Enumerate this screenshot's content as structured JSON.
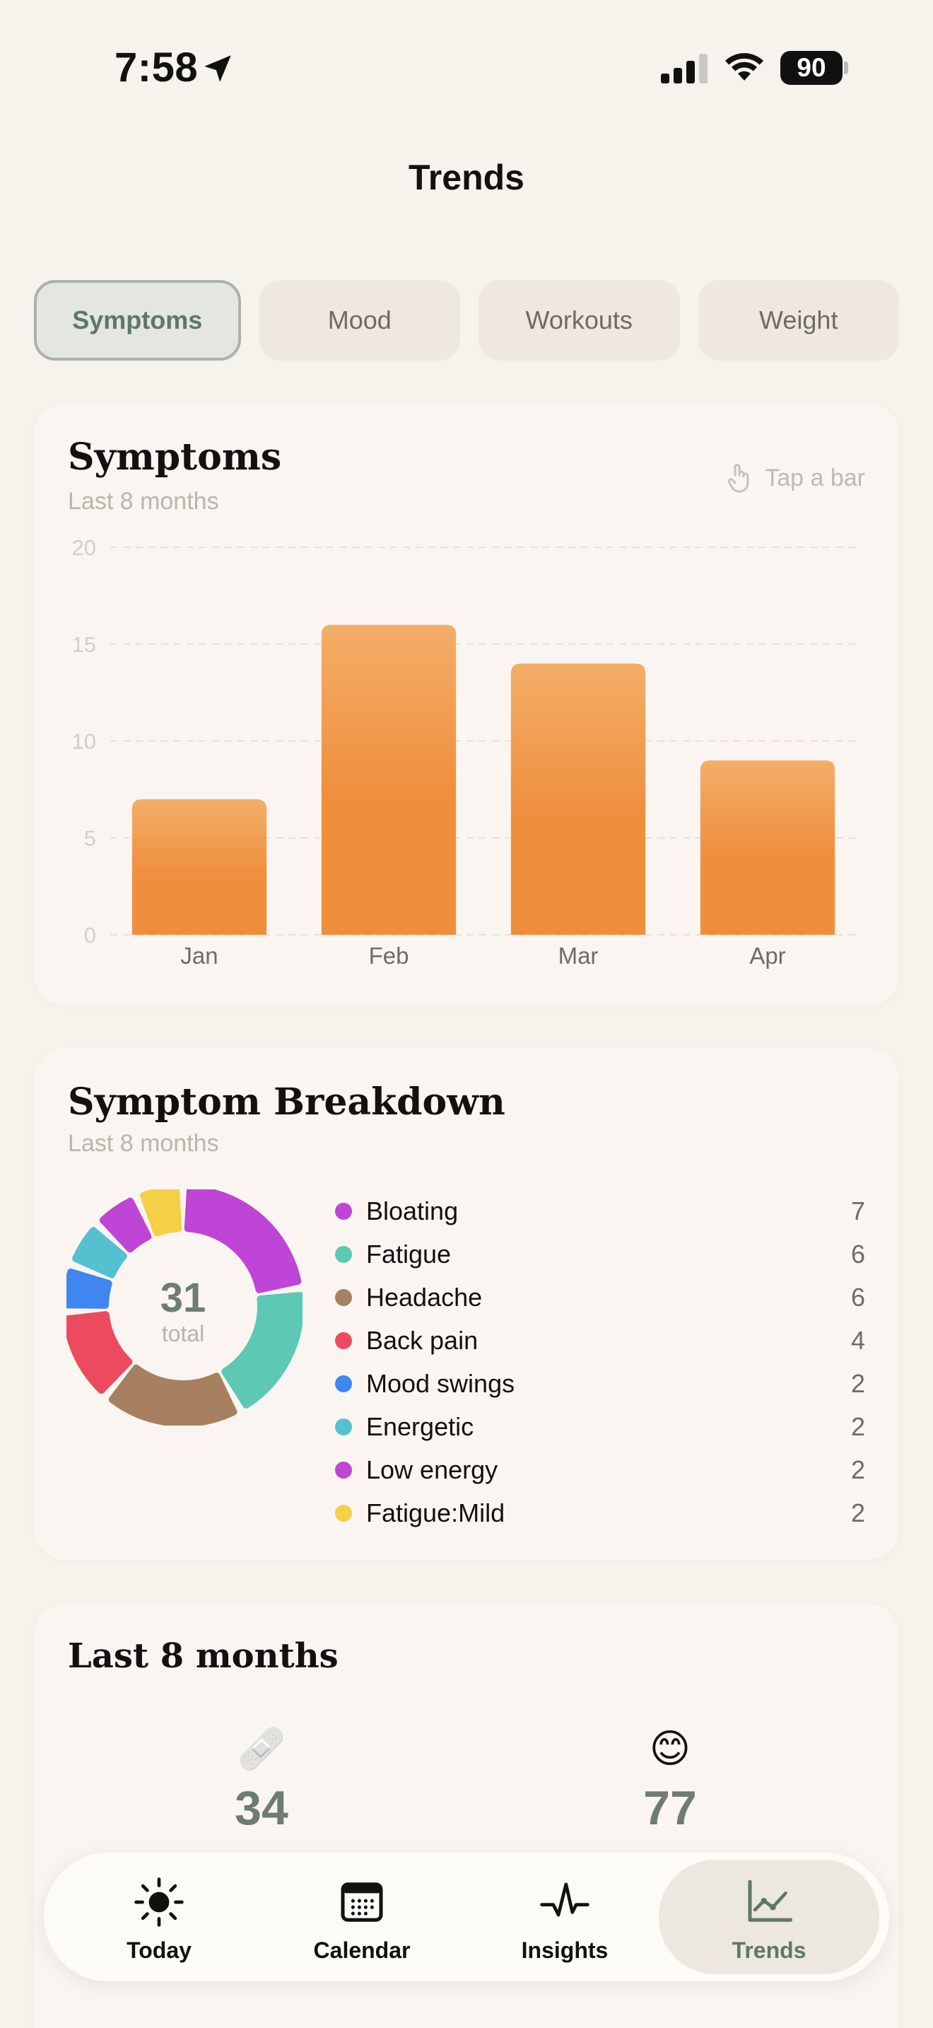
{
  "status_bar": {
    "time": "7:58",
    "battery": "90"
  },
  "page": {
    "title": "Trends"
  },
  "tabs": [
    {
      "label": "Symptoms",
      "active": true
    },
    {
      "label": "Mood",
      "active": false
    },
    {
      "label": "Workouts",
      "active": false
    },
    {
      "label": "Weight",
      "active": false
    }
  ],
  "symptoms_chart": {
    "title": "Symptoms",
    "subtitle": "Last 8 months",
    "hint": "Tap a bar",
    "bar_color_top": "#f3ae68",
    "bar_color_bottom": "#ef8f3e"
  },
  "chart_data": {
    "type": "bar",
    "categories": [
      "Jan",
      "Feb",
      "Mar",
      "Apr"
    ],
    "values": [
      7,
      16,
      14,
      9
    ],
    "yticks": [
      0,
      5,
      10,
      15,
      20
    ],
    "ylim": [
      0,
      20
    ],
    "grid": "dashed horizontal"
  },
  "breakdown": {
    "title": "Symptom Breakdown",
    "subtitle": "Last 8 months",
    "total": "31",
    "total_label": "total",
    "items": [
      {
        "label": "Bloating",
        "count": "7",
        "value": 7,
        "color": "#bf45d6"
      },
      {
        "label": "Fatigue",
        "count": "6",
        "value": 6,
        "color": "#5dc8b4"
      },
      {
        "label": "Headache",
        "count": "6",
        "value": 6,
        "color": "#a6805f"
      },
      {
        "label": "Back pain",
        "count": "4",
        "value": 4,
        "color": "#ec4b5f"
      },
      {
        "label": "Mood swings",
        "count": "2",
        "value": 2,
        "color": "#3f86f0"
      },
      {
        "label": "Energetic",
        "count": "2",
        "value": 2,
        "color": "#55c0d0"
      },
      {
        "label": "Low energy",
        "count": "2",
        "value": 2,
        "color": "#bf45d6"
      },
      {
        "label": "Fatigue:Mild",
        "count": "2",
        "value": 2,
        "color": "#f5cf45"
      }
    ]
  },
  "summary": {
    "title": "Last 8 months",
    "stats": [
      {
        "icon": "bandage-icon",
        "glyph": "🩹",
        "value": "34"
      },
      {
        "icon": "smile-icon",
        "glyph": "😊",
        "value": "77"
      }
    ]
  },
  "nav": [
    {
      "label": "Today",
      "icon": "sun-icon",
      "active": false
    },
    {
      "label": "Calendar",
      "icon": "calendar-icon",
      "active": false
    },
    {
      "label": "Insights",
      "icon": "pulse-icon",
      "active": false
    },
    {
      "label": "Trends",
      "icon": "chart-line-icon",
      "active": true
    }
  ]
}
